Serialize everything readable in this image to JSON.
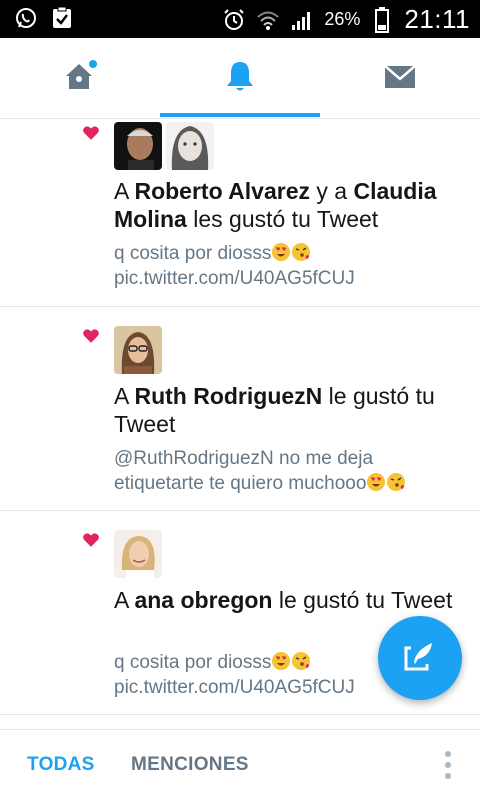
{
  "status_bar": {
    "battery": "26%",
    "time": "21:11",
    "icons": [
      "whatsapp-icon",
      "clipboard-check-icon",
      "alarm-icon",
      "wifi-icon",
      "signal-icon",
      "battery-icon"
    ]
  },
  "nav": {
    "tabs": [
      {
        "name": "home",
        "icon": "home-icon",
        "has_dot": true
      },
      {
        "name": "notifications",
        "icon": "bell-icon",
        "active": true
      },
      {
        "name": "messages",
        "icon": "envelope-icon"
      }
    ],
    "accent": "#1da1f2"
  },
  "notifications": [
    {
      "icon": "heart-icon",
      "title_prefix": "A ",
      "user1": "Roberto Alvarez",
      "connector": " y a ",
      "user2": "Claudia Molina",
      "title_suffix": " les gustó tu Tweet",
      "tweet_text": "q cosita por diosss",
      "tweet_link": "pic.twitter.com/U40AG5fCUJ"
    },
    {
      "icon": "heart-icon",
      "title_prefix": "A ",
      "user1": "Ruth RodriguezN",
      "title_suffix": " le gustó tu Tweet",
      "tweet_text_line1": "@RuthRodriguezN  no me deja",
      "tweet_text_line2": "etiquetarte te quiero muchooo"
    },
    {
      "icon": "heart-icon",
      "title_prefix": "A ",
      "user1": "ana obregon",
      "title_suffix": " le gustó tu Tweet",
      "tweet_text": "q cosita por diosss",
      "tweet_link": "pic.twitter.com/U40AG5fCUJ"
    }
  ],
  "bottom_bar": {
    "tab_all": "TODAS",
    "tab_mentions": "MENCIONES"
  },
  "colors": {
    "heart": "#e0245e",
    "secondary_text": "#657786",
    "primary_text": "#14171a",
    "divider": "#e1e8ed"
  },
  "fab": {
    "icon": "compose-tweet-icon"
  }
}
